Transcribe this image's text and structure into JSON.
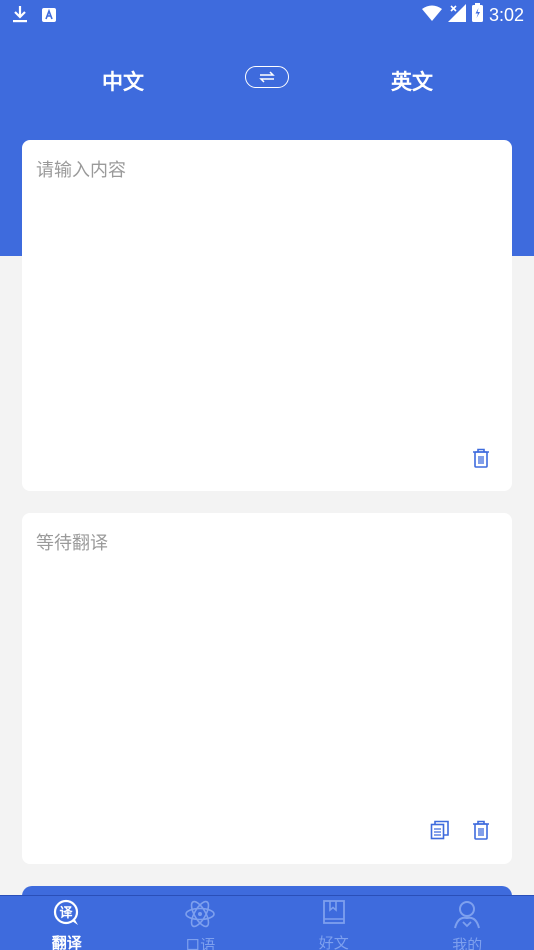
{
  "status_bar": {
    "time": "3:02",
    "left_icons": [
      "download-icon",
      "app-notification-icon"
    ],
    "right_icons": [
      "wifi-icon",
      "cellular-icon",
      "battery-icon"
    ]
  },
  "language_bar": {
    "source_language": "中文",
    "target_language": "英文",
    "swap_icon": "swap-arrows-icon"
  },
  "input_card": {
    "placeholder": "请输入内容",
    "value": "",
    "actions": [
      "trash-icon"
    ]
  },
  "output_card": {
    "placeholder": "等待翻译",
    "actions": [
      "copy-icon",
      "trash-icon"
    ]
  },
  "bottom_nav": {
    "items": [
      {
        "label": "翻译",
        "icon": "translate-bubble-icon",
        "active": true
      },
      {
        "label": "口语",
        "icon": "atom-icon",
        "active": false
      },
      {
        "label": "好文",
        "icon": "bookmark-book-icon",
        "active": false
      },
      {
        "label": "我的",
        "icon": "person-icon",
        "active": false
      }
    ]
  },
  "colors": {
    "primary": "#3e6bdd",
    "background": "#f3f3f3",
    "placeholder": "#9a9a9a",
    "nav_inactive": "#7ea0ee"
  }
}
